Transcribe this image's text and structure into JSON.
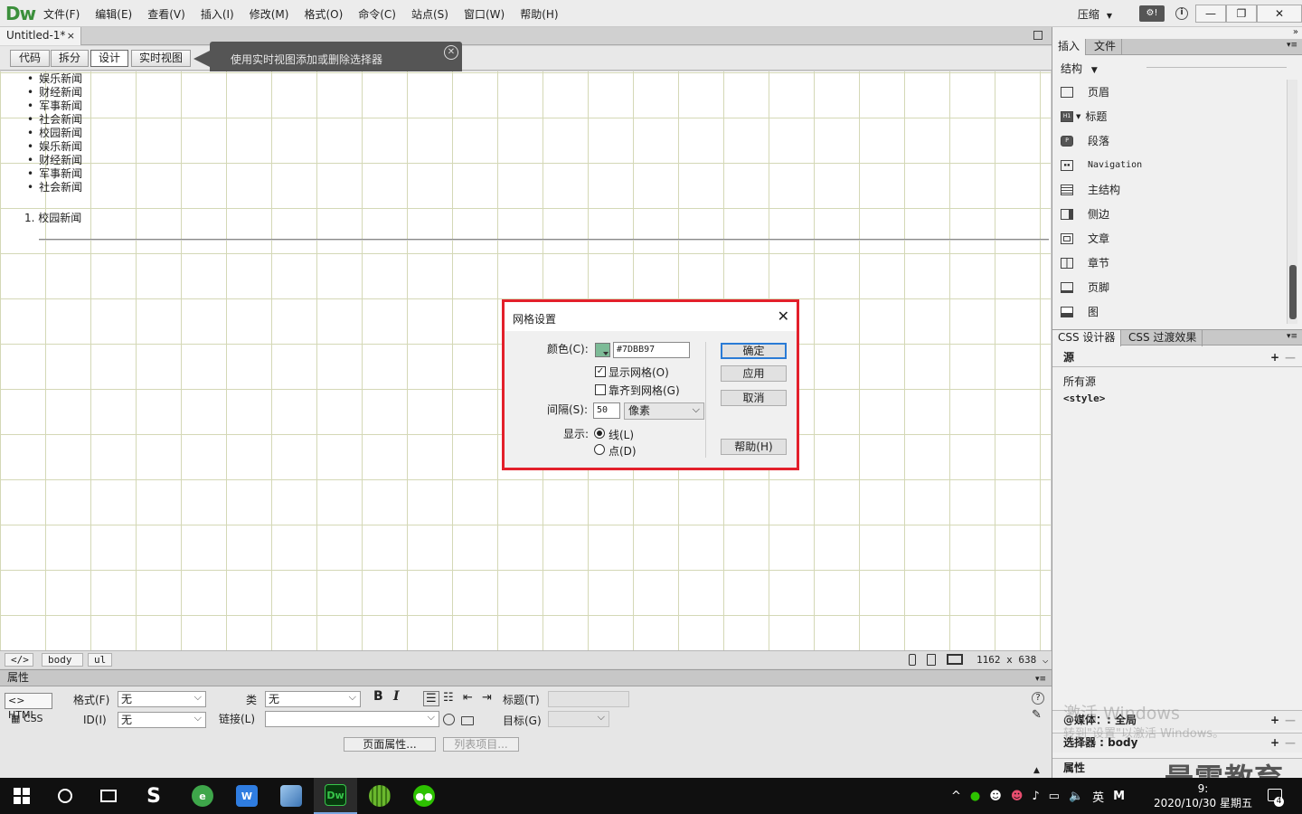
{
  "app": {
    "logo": "Dw",
    "menu": [
      "文件(F)",
      "编辑(E)",
      "查看(V)",
      "插入(I)",
      "修改(M)",
      "格式(O)",
      "命令(C)",
      "站点(S)",
      "窗口(W)",
      "帮助(H)"
    ],
    "compress_label": "压缩",
    "window_controls": {
      "minimize": "—",
      "restore": "❐",
      "close": "✕"
    }
  },
  "document": {
    "tab_title": "Untitled-1*",
    "tab_close": "×",
    "view_buttons": [
      "代码",
      "拆分",
      "设计",
      "实时视图"
    ],
    "active_view": "设计",
    "tooltip": "使用实时视图添加或删除选择器",
    "ul_items": [
      "娱乐新闻",
      "财经新闻",
      "军事新闻",
      "社会新闻",
      "校园新闻",
      "娱乐新闻",
      "财经新闻",
      "军事新闻",
      "社会新闻"
    ],
    "ol_items": [
      {
        "num": "1.",
        "text": "校园新闻"
      }
    ],
    "grid_color": "#d4d8b6"
  },
  "statusbar": {
    "code_tag": "</>",
    "tags": [
      "body",
      "ul"
    ],
    "size": "1162 x 638"
  },
  "properties": {
    "title": "属性",
    "html_btn": "<> HTML",
    "css_btn": "CSS",
    "format_label": "格式(F)",
    "format_value": "无",
    "id_label": "ID(I)",
    "id_value": "无",
    "class_label": "类",
    "class_value": "无",
    "link_label": "链接(L)",
    "link_value": "",
    "bold": "B",
    "italic": "I",
    "heading_label": "标题(T)",
    "target_label": "目标(G)",
    "page_props_btn": "页面属性...",
    "list_item_btn": "列表项目..."
  },
  "insert_panel": {
    "tabs": [
      "插入",
      "文件"
    ],
    "category": "结构",
    "items": [
      "页眉",
      "标题",
      "段落",
      "Navigation",
      "主结构",
      "侧边",
      "文章",
      "章节",
      "页脚",
      "图"
    ]
  },
  "css_panel": {
    "tabs": [
      "CSS 设计器",
      "CSS 过渡效果"
    ],
    "source_header": "源",
    "sources": [
      "所有源",
      "<style>"
    ],
    "media_label": "@媒体：: 全局",
    "selector_label": "选择器 : body",
    "props_label": "属性",
    "plus": "+",
    "minus": "—"
  },
  "watermark": {
    "line1": "激活 Windows",
    "line2": "转到\"设置\"以激活 Windows。",
    "brand": "最需教育"
  },
  "dialog": {
    "title": "网格设置",
    "close": "✕",
    "color_label": "颜色(C):",
    "color_value": "#7DBB97",
    "swatch_color": "#7dbb97",
    "show_grid_label": "显示网格(O)",
    "show_grid_checked": true,
    "snap_grid_label": "靠齐到网格(G)",
    "snap_grid_checked": false,
    "spacing_label": "间隔(S):",
    "spacing_value": "50",
    "unit_value": "像素",
    "display_label": "显示:",
    "display_options": [
      {
        "label": "线(L)",
        "selected": true
      },
      {
        "label": "点(D)",
        "selected": false
      }
    ],
    "ok_btn": "确定",
    "apply_btn": "应用",
    "cancel_btn": "取消",
    "help_btn": "帮助(H)",
    "highlight_color": "#e3202b"
  },
  "taskbar": {
    "tray": [
      "^",
      "英",
      "M"
    ],
    "time": "9:",
    "date": "2020/10/30 星期五",
    "notif_count": "4"
  }
}
